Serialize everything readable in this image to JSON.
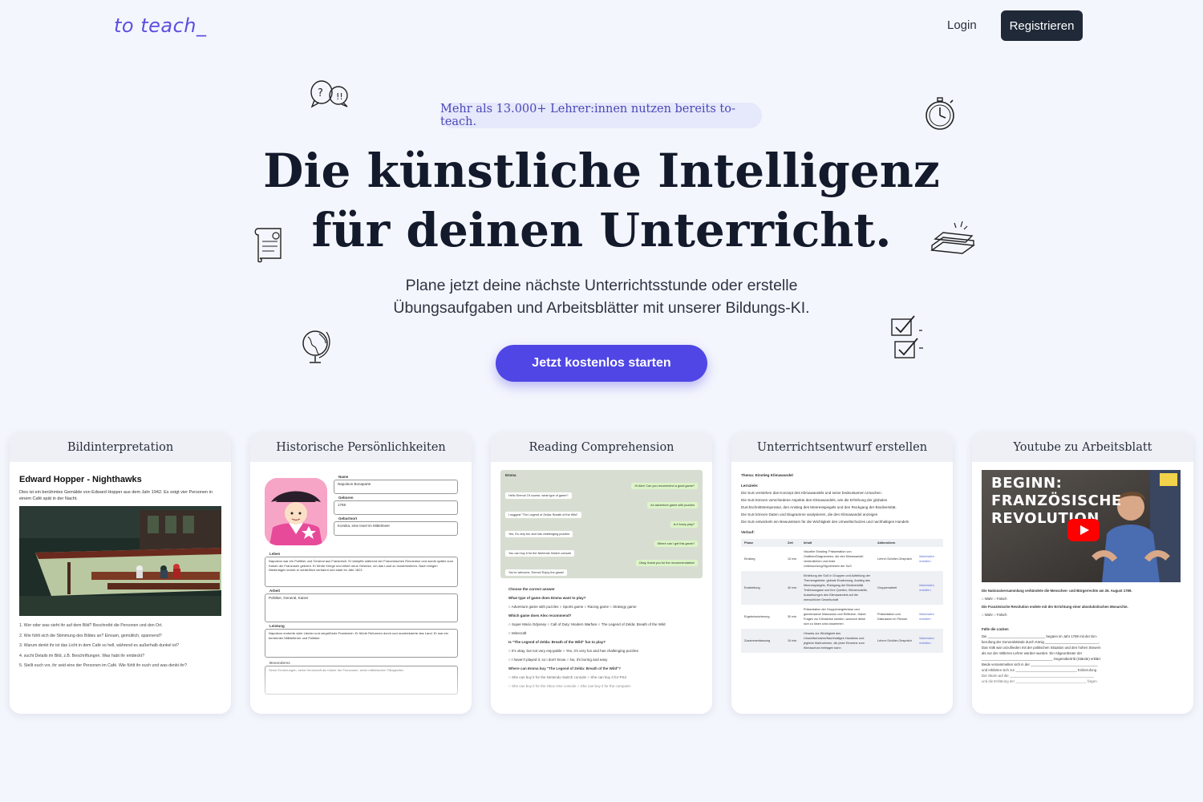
{
  "header": {
    "logo": "to teach_",
    "login": "Login",
    "register": "Registrieren"
  },
  "hero": {
    "badge": "Mehr als 13.000+ Lehrer:innen nutzen bereits to-teach.",
    "headline_line1": "Die künstliche Intelligenz",
    "headline_line2": "für deinen Unterricht.",
    "subline_line1": "Plane jetzt deine nächste Unterrichtsstunde oder erstelle",
    "subline_line2": "Übungsaufgaben und Arbeitsblätter mit unserer Bildungs-KI.",
    "cta": "Jetzt kostenlos starten"
  },
  "doodles": [
    "chat-bubbles-icon",
    "stopwatch-icon",
    "scroll-icon",
    "books-icon",
    "globe-icon",
    "checklist-icon"
  ],
  "colors": {
    "accent": "#4f46e5",
    "logo": "#5a4fe0",
    "dark": "#1f2937",
    "background": "#f4f6fd"
  },
  "cards": [
    {
      "title": "Bildinterpretation",
      "doc_title": "Edward Hopper - Nighthawks",
      "intro": "Dies ist ein berühmtes Gemälde von Edward Hopper aus dem Jahr 1942. Es zeigt vier Personen in einem Café spät in der Nacht.",
      "questions": [
        "1. Wer oder was sieht ihr auf dem Bild? Beschreibt die Personen und den Ort.",
        "2. Wie fühlt sich die Stimmung des Bildes an? Einsam, gemütlich, spannend?",
        "3. Warum denkt ihr ist das Licht in dem Café so hell, während es außerhalb dunkel ist?",
        "4. sucht Details im Bild, z.B. Beschriftungen. Was habt ihr entdeckt?",
        "5. Stellt euch vor, ihr seid eine der Personen im Café. Wie fühlt ihr euch und was denkt ihr?"
      ]
    },
    {
      "title": "Historische Persönlichkeiten",
      "fields": [
        {
          "label": "Name",
          "value": "Napoleon Bonaparte"
        },
        {
          "label": "Geboren",
          "value": "1769"
        },
        {
          "label": "Geburtsort",
          "value": "Korsika, eine Insel im Mittelmeer"
        },
        {
          "label": "Leben",
          "value": "Napoleon war ein Politiker und General aus Frankreich. Er kämpfte während der Französischen Revolution und wurde später zum Kaiser der Franzosen gekrönt. Er führte Kriege und erließ neue Gesetze, um das Land zu modernisieren. Nach einigen Niederlagen wurde er schließlich verbannt und starb im Jahr 1821."
        },
        {
          "label": "Arbeit",
          "value": "Politiker, General, Kaiser"
        },
        {
          "label": "Leistung",
          "value": "Napoleon eroberte viele Länder und vergrößerte Frankreich. Er führte Reformen durch und modernisierte das Land. Er war ein berühmter Militärführer und Politiker."
        },
        {
          "label": "Besonderes",
          "value": "Seine Eroberungen, seine Herrschaft als Kaiser der Franzosen, seine militärischen Fähigkeiten"
        }
      ]
    },
    {
      "title": "Reading Comprehension",
      "chat_name": "Emma",
      "chat": [
        {
          "side": "r",
          "text": "Hi Alex! Can you recommend a good game?"
        },
        {
          "side": "l",
          "text": "Hello Emma! Of course, what type of game?"
        },
        {
          "side": "r",
          "text": "An adventure game with puzzles"
        },
        {
          "side": "l",
          "text": "I suggest \"The Legend of Zelda: Breath of the Wild\""
        },
        {
          "side": "r",
          "text": "Is it funny play?"
        },
        {
          "side": "l",
          "text": "Yes, it's very fun and has challenging puzzles"
        },
        {
          "side": "r",
          "text": "Where can I get this game?"
        },
        {
          "side": "l",
          "text": "You can buy it for the Nintendo Switch console"
        },
        {
          "side": "r",
          "text": "Okay, thank you for the recommendation!"
        },
        {
          "side": "l",
          "text": "You're welcome, Emma! Enjoy the game!"
        }
      ],
      "quiz": [
        "Choose the correct answer",
        "What type of game does Emma want to play?",
        "○ Adventure game with puzzles   ○ Sports game   ○ Racing game   ○ Strategy game",
        "Which game does Alex recommend?",
        "○ Super Mario Odyssey   ○ Call of Duty: Modern Warfare   ○ The Legend of Zelda: Breath of the Wild",
        "○ Minecraft",
        "Is \"The Legend of Zelda: Breath of the Wild\" fun to play?",
        "○ It's okay, but not very enjoyable   ○ Yes, it's very fun and has challenging puzzles",
        "○ I haven't played it, so I don't know   ○ No, it's boring and easy",
        "Where can Emma buy \"The Legend of Zelda: Breath of the Wild\"?",
        "○ She can buy it for the Nintendo Switch console   ○ She can buy it for PS4",
        "○ She can buy it for the Xbox One console   ○ She can buy it for the computer"
      ]
    },
    {
      "title": "Unterrichtsentwurf erstellen",
      "topic": "Thema: Einstieg Klimawandel",
      "goals_label": "Lernziele:",
      "goals": [
        "Die SuS verstehen das Konzept des Klimawandels und seine bedeutsamen Ursachen.",
        "Die SuS können verschiedene Aspekte des Klimawandels, wie die Erhöhung der globalen",
        "Durchschnittstemperatur, den Anstieg des Meeresspiegels und den Rückgang der Biodiversität.",
        "Die SuS können Daten und Diagramme analysieren, die den Klimawandel anzeigen",
        "Die SuS entwickeln ein Bewusstsein für die Wichtigkeit des Umweltschutzes und nachhaltiges Handeln"
      ],
      "plan_label": "Verlauf:",
      "columns": [
        "Phase",
        "Zeit",
        "Inhalt",
        "Aktionsform",
        ""
      ],
      "rows": [
        {
          "phase": "Einstieg",
          "time": "10 min",
          "content": "Visueller Einstieg: Präsentation von Grafiken/Diagrammen, die den Klimawandel verdeutlichen und erste Untersuchung/Hypothesen der SuS",
          "form": "Lehrer-Schüler-Gespräch",
          "link": "Materialien erstellen"
        },
        {
          "phase": "Erarbeitung",
          "time": "40 min",
          "content": "Einteilung der SuS in Gruppen und Aufteilung der Themengebiete: globale Erwärmung, Anstieg des Meeresspiegels, Rückgang der Biodiversität. Treibhausgase und ihre Quellen, Klimamodelle, Auswirkungen des Klimawandels auf die menschliche Gesellschaft",
          "form": "Gruppenarbeit",
          "link": "Materialien erstellen"
        },
        {
          "phase": "Ergebnissicherung",
          "time": "30 min",
          "content": "Präsentation der Gruppenergebnisse und gemeinsame Diskussion und Reflexion. Dabei Fragen zur Klimakrise werden, wodurch diese sich zu lösen sind zusammen",
          "form": "Präsentation und Diskussion im Plenum",
          "link": "Materialien erstellen"
        },
        {
          "phase": "Zusammenfassung",
          "time": "10 min",
          "content": "Hinweis zur Wichtigkeit des Umweltschutzes/Nachhaltigen Handelns und jegliche Maßnahmen, die jeder Einzelne zum Klimaschutz beitragen kann",
          "form": "Lehrer-Schüler-Gespräch",
          "link": "Materialien erstellen"
        }
      ]
    },
    {
      "title": "Youtube zu Arbeitsblatt",
      "thumb_line1": "BEGINN:",
      "thumb_line2": "FRANZÖSISCHE",
      "thumb_line3": "REVOLUTION",
      "lines": [
        "Die Nationalversammlung verkündete die Menschen- und Bürgerrechte am 26. August 1789.",
        "○ Wahr   ○ Falsch",
        "Die Französische Revolution endete mit der Errichtung einer absolutistischen Monarchie.",
        "○ Wahr   ○ Falsch",
        "",
        "Fülle die Lücken",
        "Die ______________________________ begann im Jahr 1789 mit der Ein-",
        "berufung der Generalstände durch König ____________________________.",
        "Das Volk war unzufrieden mit der politischen Situation und den hohen Steuern",
        "als nur der mittleren Lehrer würden wurden. Ein Abgeordneter der",
        "_____________________________________ Gegenübertritt (Stände) erklärt",
        "Beide versammelten sich in der ___________________________________",
        "und erklärten sich zur ________________________________ Einberufung",
        "Der Sturm auf die ____________________________________________",
        "und die Erklärung der _____________________________________ folgen."
      ]
    }
  ]
}
